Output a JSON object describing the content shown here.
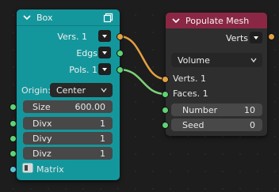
{
  "colors": {
    "box_node": "#14979c",
    "populate_header": "#8a2744",
    "socket_vertices": "#e3a044",
    "socket_int": "#5fd374",
    "socket_matrix": "#5ac3d6"
  },
  "box": {
    "title": "Box",
    "outputs": [
      "Vers. 1",
      "Edgs",
      "Pols. 1"
    ],
    "origin_label": "Origin:",
    "origin_value": "Center",
    "fields": [
      {
        "label": "Size",
        "value": "600.00"
      },
      {
        "label": "Divx",
        "value": "1"
      },
      {
        "label": "Divy",
        "value": "1"
      },
      {
        "label": "Divz",
        "value": "1"
      }
    ],
    "matrix_label": "Matrix"
  },
  "populate": {
    "title": "Populate Mesh",
    "output": "Verts",
    "mode_value": "Volume",
    "inputs": [
      "Verts. 1",
      "Faces. 1"
    ],
    "fields": [
      {
        "label": "Number",
        "value": "10"
      },
      {
        "label": "Seed",
        "value": "0"
      }
    ]
  }
}
